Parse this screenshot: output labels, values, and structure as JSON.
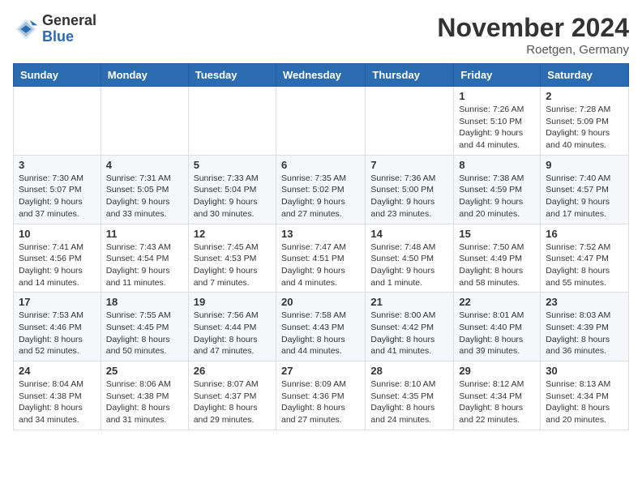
{
  "header": {
    "logo_general": "General",
    "logo_blue": "Blue",
    "month_title": "November 2024",
    "location": "Roetgen, Germany"
  },
  "weekdays": [
    "Sunday",
    "Monday",
    "Tuesday",
    "Wednesday",
    "Thursday",
    "Friday",
    "Saturday"
  ],
  "weeks": [
    [
      {
        "day": "",
        "info": ""
      },
      {
        "day": "",
        "info": ""
      },
      {
        "day": "",
        "info": ""
      },
      {
        "day": "",
        "info": ""
      },
      {
        "day": "",
        "info": ""
      },
      {
        "day": "1",
        "info": "Sunrise: 7:26 AM\nSunset: 5:10 PM\nDaylight: 9 hours and 44 minutes."
      },
      {
        "day": "2",
        "info": "Sunrise: 7:28 AM\nSunset: 5:09 PM\nDaylight: 9 hours and 40 minutes."
      }
    ],
    [
      {
        "day": "3",
        "info": "Sunrise: 7:30 AM\nSunset: 5:07 PM\nDaylight: 9 hours and 37 minutes."
      },
      {
        "day": "4",
        "info": "Sunrise: 7:31 AM\nSunset: 5:05 PM\nDaylight: 9 hours and 33 minutes."
      },
      {
        "day": "5",
        "info": "Sunrise: 7:33 AM\nSunset: 5:04 PM\nDaylight: 9 hours and 30 minutes."
      },
      {
        "day": "6",
        "info": "Sunrise: 7:35 AM\nSunset: 5:02 PM\nDaylight: 9 hours and 27 minutes."
      },
      {
        "day": "7",
        "info": "Sunrise: 7:36 AM\nSunset: 5:00 PM\nDaylight: 9 hours and 23 minutes."
      },
      {
        "day": "8",
        "info": "Sunrise: 7:38 AM\nSunset: 4:59 PM\nDaylight: 9 hours and 20 minutes."
      },
      {
        "day": "9",
        "info": "Sunrise: 7:40 AM\nSunset: 4:57 PM\nDaylight: 9 hours and 17 minutes."
      }
    ],
    [
      {
        "day": "10",
        "info": "Sunrise: 7:41 AM\nSunset: 4:56 PM\nDaylight: 9 hours and 14 minutes."
      },
      {
        "day": "11",
        "info": "Sunrise: 7:43 AM\nSunset: 4:54 PM\nDaylight: 9 hours and 11 minutes."
      },
      {
        "day": "12",
        "info": "Sunrise: 7:45 AM\nSunset: 4:53 PM\nDaylight: 9 hours and 7 minutes."
      },
      {
        "day": "13",
        "info": "Sunrise: 7:47 AM\nSunset: 4:51 PM\nDaylight: 9 hours and 4 minutes."
      },
      {
        "day": "14",
        "info": "Sunrise: 7:48 AM\nSunset: 4:50 PM\nDaylight: 9 hours and 1 minute."
      },
      {
        "day": "15",
        "info": "Sunrise: 7:50 AM\nSunset: 4:49 PM\nDaylight: 8 hours and 58 minutes."
      },
      {
        "day": "16",
        "info": "Sunrise: 7:52 AM\nSunset: 4:47 PM\nDaylight: 8 hours and 55 minutes."
      }
    ],
    [
      {
        "day": "17",
        "info": "Sunrise: 7:53 AM\nSunset: 4:46 PM\nDaylight: 8 hours and 52 minutes."
      },
      {
        "day": "18",
        "info": "Sunrise: 7:55 AM\nSunset: 4:45 PM\nDaylight: 8 hours and 50 minutes."
      },
      {
        "day": "19",
        "info": "Sunrise: 7:56 AM\nSunset: 4:44 PM\nDaylight: 8 hours and 47 minutes."
      },
      {
        "day": "20",
        "info": "Sunrise: 7:58 AM\nSunset: 4:43 PM\nDaylight: 8 hours and 44 minutes."
      },
      {
        "day": "21",
        "info": "Sunrise: 8:00 AM\nSunset: 4:42 PM\nDaylight: 8 hours and 41 minutes."
      },
      {
        "day": "22",
        "info": "Sunrise: 8:01 AM\nSunset: 4:40 PM\nDaylight: 8 hours and 39 minutes."
      },
      {
        "day": "23",
        "info": "Sunrise: 8:03 AM\nSunset: 4:39 PM\nDaylight: 8 hours and 36 minutes."
      }
    ],
    [
      {
        "day": "24",
        "info": "Sunrise: 8:04 AM\nSunset: 4:38 PM\nDaylight: 8 hours and 34 minutes."
      },
      {
        "day": "25",
        "info": "Sunrise: 8:06 AM\nSunset: 4:38 PM\nDaylight: 8 hours and 31 minutes."
      },
      {
        "day": "26",
        "info": "Sunrise: 8:07 AM\nSunset: 4:37 PM\nDaylight: 8 hours and 29 minutes."
      },
      {
        "day": "27",
        "info": "Sunrise: 8:09 AM\nSunset: 4:36 PM\nDaylight: 8 hours and 27 minutes."
      },
      {
        "day": "28",
        "info": "Sunrise: 8:10 AM\nSunset: 4:35 PM\nDaylight: 8 hours and 24 minutes."
      },
      {
        "day": "29",
        "info": "Sunrise: 8:12 AM\nSunset: 4:34 PM\nDaylight: 8 hours and 22 minutes."
      },
      {
        "day": "30",
        "info": "Sunrise: 8:13 AM\nSunset: 4:34 PM\nDaylight: 8 hours and 20 minutes."
      }
    ]
  ]
}
